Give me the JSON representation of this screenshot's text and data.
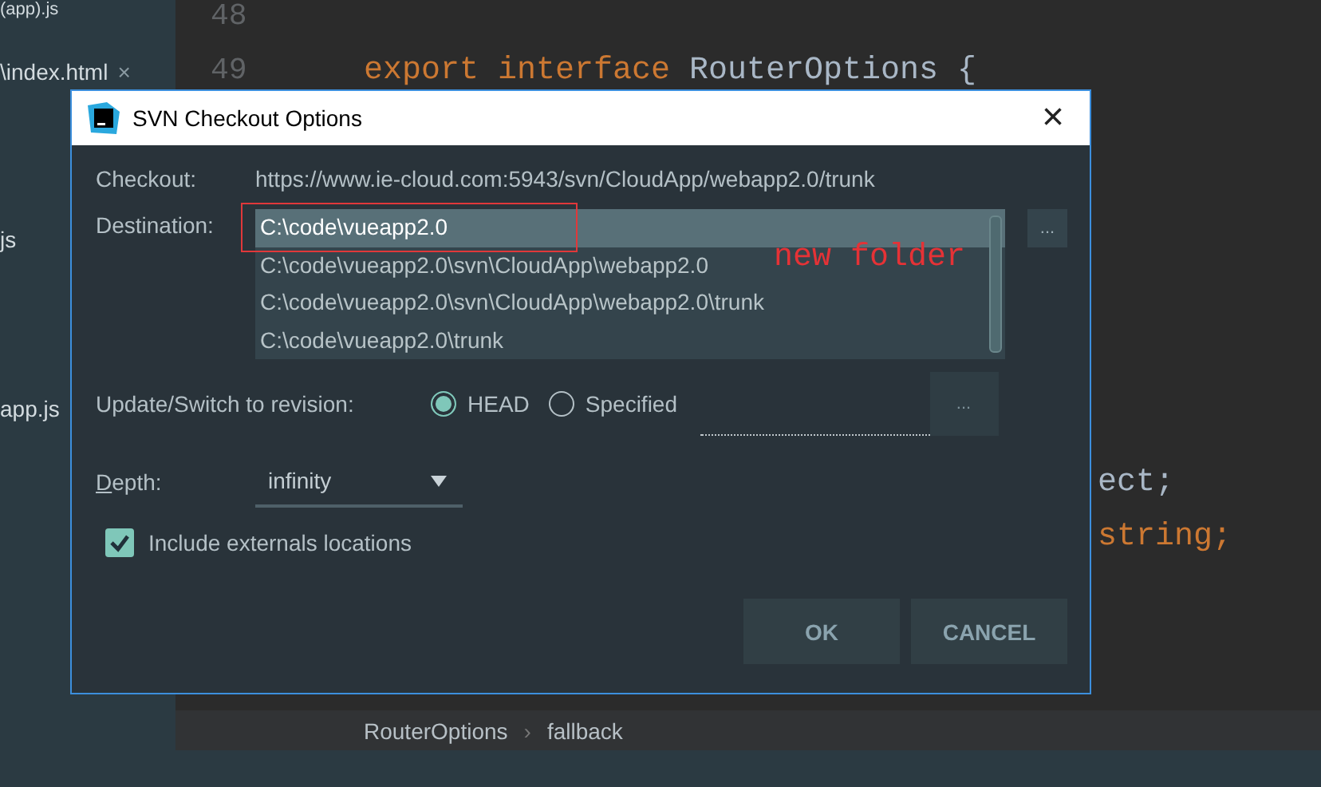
{
  "sidebar": {
    "items": [
      {
        "label": "(app).js"
      },
      {
        "label": "\\index.html",
        "close": "×"
      },
      {
        "label": "js"
      },
      {
        "label": "app.js"
      }
    ]
  },
  "editor": {
    "lines": [
      {
        "number": "48"
      },
      {
        "number": "49",
        "keyword": "export interface",
        "code": "RouterOptions {"
      },
      {
        "code": "ect;"
      },
      {
        "keyword": "string;"
      }
    ]
  },
  "breadcrumb": {
    "items": [
      "RouterOptions",
      "fallback"
    ],
    "separator": "›"
  },
  "dialog": {
    "title": "SVN Checkout Options",
    "close": "×",
    "checkout": {
      "label": "Checkout:",
      "url": "https://www.ie-cloud.com:5943/svn/CloudApp/webapp2.0/trunk"
    },
    "destination": {
      "label": "Destination:",
      "browse": "...",
      "options": [
        {
          "path": "C:\\code\\vueapp2.0",
          "selected": true
        },
        {
          "path": "C:\\code\\vueapp2.0\\svn\\CloudApp\\webapp2.0",
          "selected": false
        },
        {
          "path": "C:\\code\\vueapp2.0\\svn\\CloudApp\\webapp2.0\\trunk",
          "selected": false
        },
        {
          "path": "C:\\code\\vueapp2.0\\trunk",
          "selected": false
        }
      ]
    },
    "revision": {
      "label": "Update/Switch to revision:",
      "options": [
        {
          "label": "HEAD",
          "selected": true
        },
        {
          "label": "Specified",
          "selected": false
        }
      ],
      "browse": "..."
    },
    "depth": {
      "label": "Depth:",
      "value": "infinity"
    },
    "externals": {
      "label": "Include externals locations",
      "checked": true
    },
    "buttons": [
      "OK",
      "CANCEL"
    ]
  },
  "annotation": {
    "text": "new folder"
  }
}
